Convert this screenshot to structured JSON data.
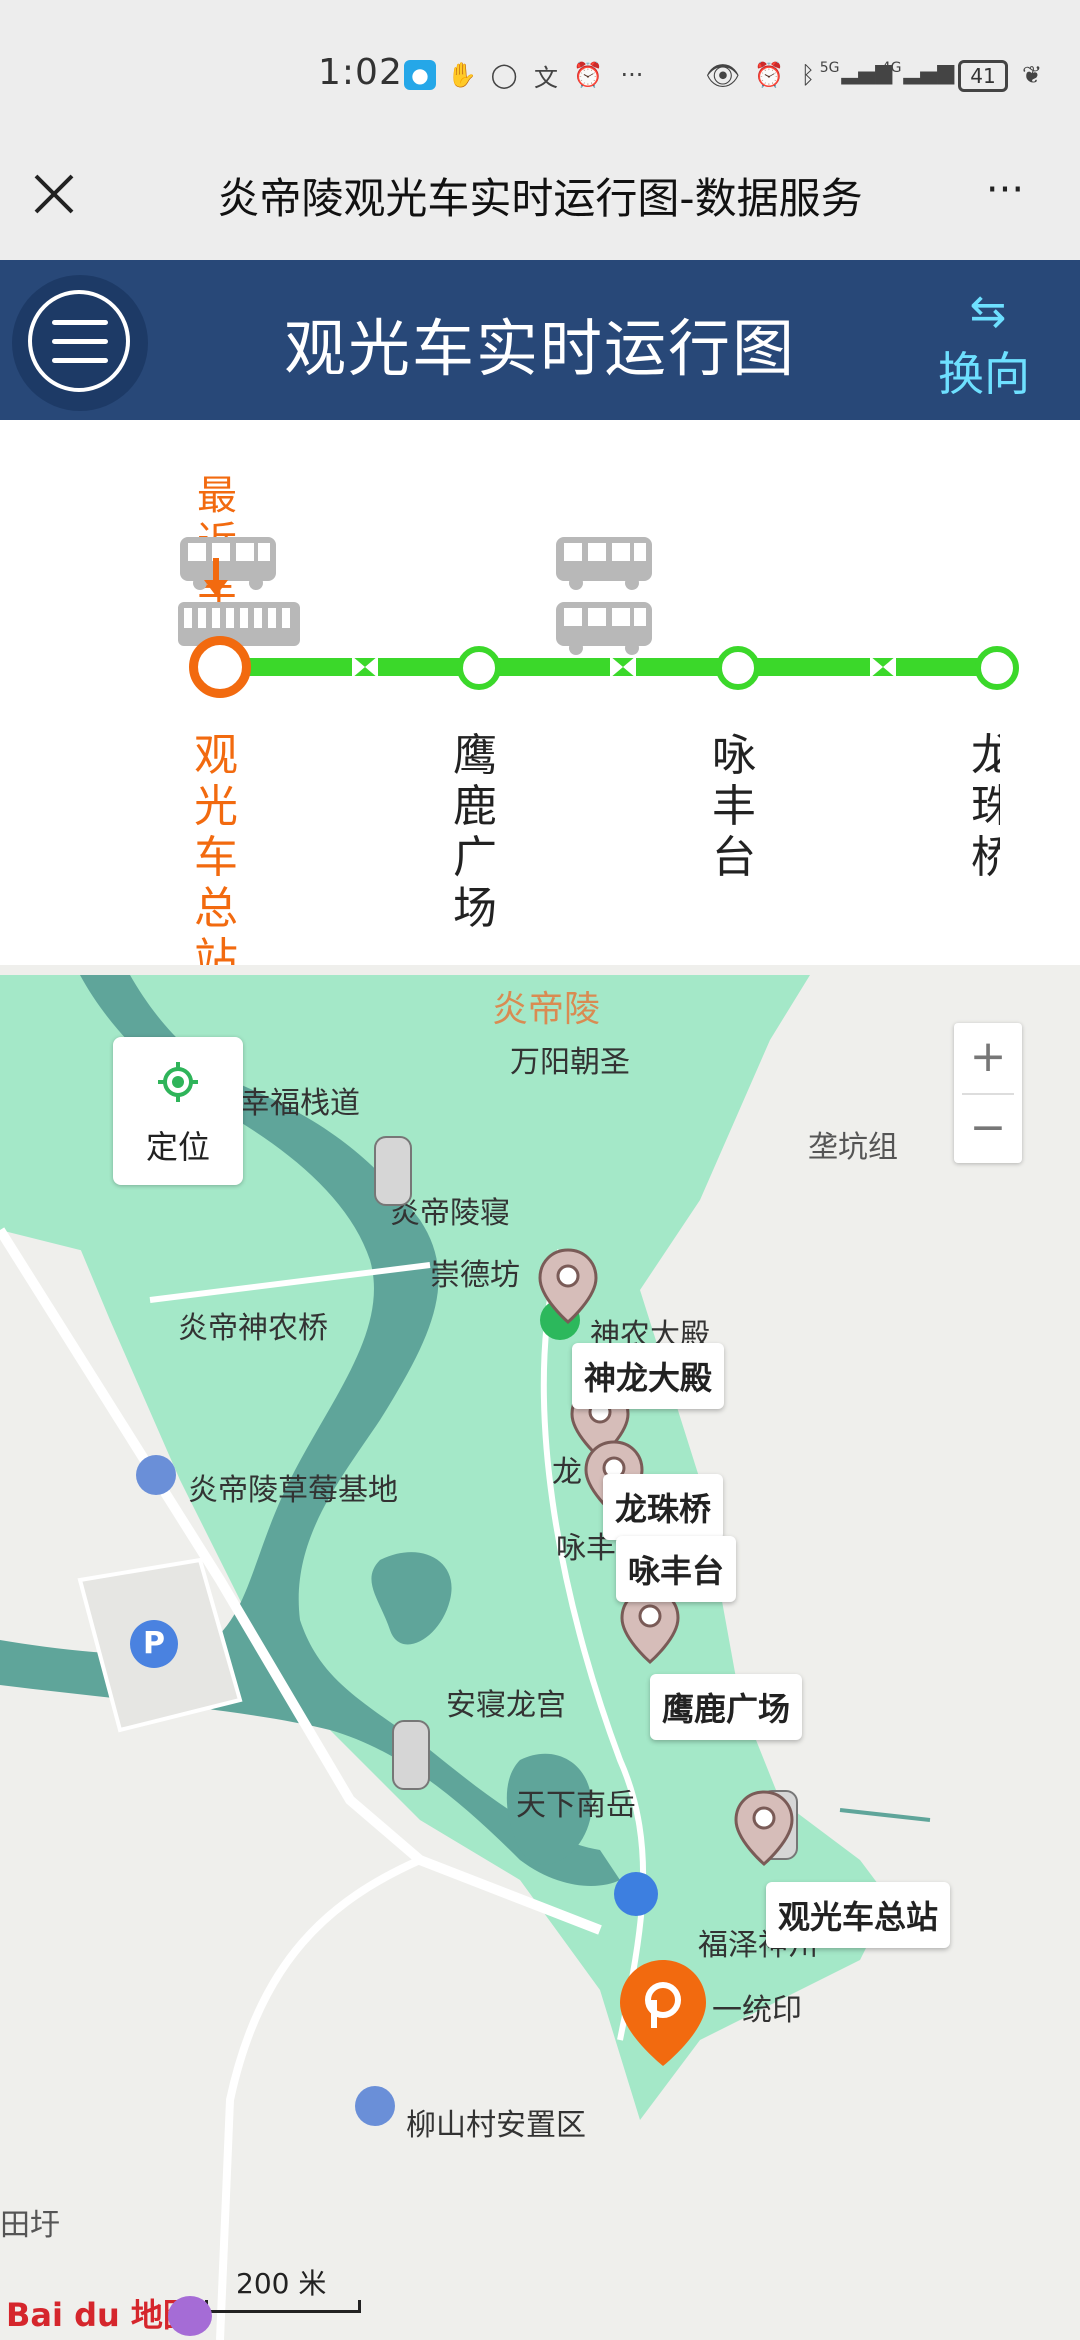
{
  "status_bar": {
    "time": "1:02",
    "battery": "41",
    "ellipsis": "···",
    "net_5g": "5G",
    "net_4g": "4G"
  },
  "title_bar": {
    "title": "炎帝陵观光车实时运行图-数据服务",
    "more": "···"
  },
  "app_header": {
    "title": "观光车实时运行图",
    "switch_label": "换向"
  },
  "route": {
    "nearest_label": "最近车",
    "stops": [
      {
        "name": "观光车总站",
        "active": true
      },
      {
        "name": "鹰鹿广场",
        "active": false
      },
      {
        "name": "咏丰台",
        "active": false
      },
      {
        "name": "龙珠桥",
        "active": false
      }
    ]
  },
  "map": {
    "locate_label": "定位",
    "zoom_in": "+",
    "zoom_out": "−",
    "places": [
      "炎帝陵",
      "万阳朝圣",
      "幸福栈道",
      "炎帝陵寝",
      "崇德坊",
      "神农大殿",
      "炎帝神农桥",
      "龙",
      "咏丰",
      "炎帝陵草莓基地",
      "安寝龙宫",
      "天下南岳",
      "福泽神州",
      "一统印",
      "柳山村安置区",
      "垄坑组",
      "田圩"
    ],
    "callouts": [
      "神龙大殿",
      "龙珠桥",
      "咏丰台",
      "鹰鹿广场",
      "观光车总站"
    ],
    "scale": "200 米",
    "logo_text": "Bai du 地图",
    "parking": "P"
  },
  "colors": {
    "header_bg": "#284878",
    "route_green": "#3bd82a",
    "active_orange": "#f26a0f",
    "switch_cyan": "#6ee0ff",
    "map_green": "#a4e8c8",
    "river": "#5fa59a"
  }
}
